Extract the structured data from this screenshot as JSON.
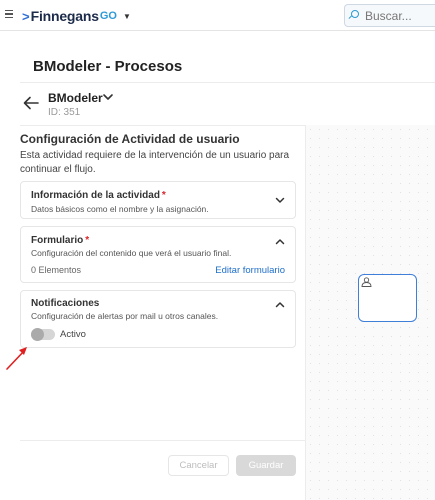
{
  "topbar": {
    "logo_chevron": ">",
    "logo_text": "Finnegans",
    "logo_suffix": "GO",
    "logo_caret": "▼",
    "search_placeholder": "Buscar..."
  },
  "page": {
    "title": "BModeler - Procesos"
  },
  "process": {
    "name": "BModeler",
    "id": "ID: 351"
  },
  "activity": {
    "title": "Configuración de Actividad de usuario",
    "description": "Esta actividad requiere de la intervención de un usuario para continuar el flujo."
  },
  "cards": {
    "info": {
      "title": "Información de la actividad",
      "required": "*",
      "subtitle": "Datos básicos como el nombre y la asignación.",
      "chevron": "chevron-down"
    },
    "form": {
      "title": "Formulario",
      "required": "*",
      "subtitle": "Configuración del contenido que verá el usuario final.",
      "count": "0 Elementos",
      "edit_label": "Editar formulario",
      "chevron": "chevron-up"
    },
    "notifications": {
      "title": "Notificaciones",
      "subtitle": "Configuración de alertas por mail u otros canales.",
      "toggle_label": "Activo",
      "toggle_on": false,
      "chevron": "chevron-up"
    }
  },
  "footer": {
    "cancel_label": "Cancelar",
    "save_label": "Guardar"
  },
  "colors": {
    "accent": "#1f6fc9",
    "required": "#d9262c",
    "annotation_arrow": "#e02020"
  }
}
